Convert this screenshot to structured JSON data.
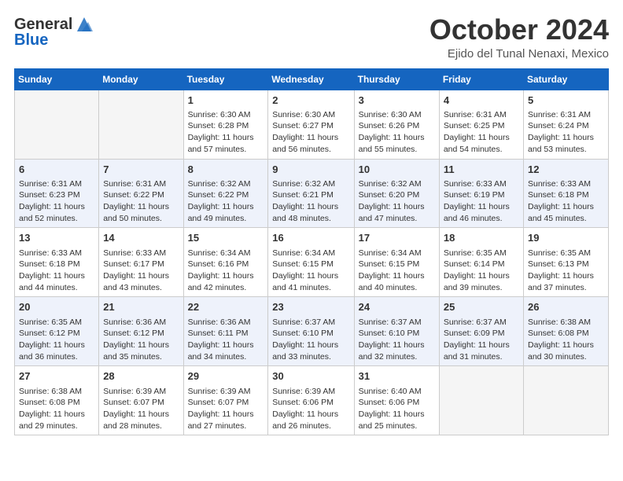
{
  "header": {
    "logo_line1": "General",
    "logo_line2": "Blue",
    "month": "October 2024",
    "location": "Ejido del Tunal Nenaxi, Mexico"
  },
  "weekdays": [
    "Sunday",
    "Monday",
    "Tuesday",
    "Wednesday",
    "Thursday",
    "Friday",
    "Saturday"
  ],
  "weeks": [
    [
      {
        "day": "",
        "sunrise": "",
        "sunset": "",
        "daylight": ""
      },
      {
        "day": "",
        "sunrise": "",
        "sunset": "",
        "daylight": ""
      },
      {
        "day": "1",
        "sunrise": "Sunrise: 6:30 AM",
        "sunset": "Sunset: 6:28 PM",
        "daylight": "Daylight: 11 hours and 57 minutes."
      },
      {
        "day": "2",
        "sunrise": "Sunrise: 6:30 AM",
        "sunset": "Sunset: 6:27 PM",
        "daylight": "Daylight: 11 hours and 56 minutes."
      },
      {
        "day": "3",
        "sunrise": "Sunrise: 6:30 AM",
        "sunset": "Sunset: 6:26 PM",
        "daylight": "Daylight: 11 hours and 55 minutes."
      },
      {
        "day": "4",
        "sunrise": "Sunrise: 6:31 AM",
        "sunset": "Sunset: 6:25 PM",
        "daylight": "Daylight: 11 hours and 54 minutes."
      },
      {
        "day": "5",
        "sunrise": "Sunrise: 6:31 AM",
        "sunset": "Sunset: 6:24 PM",
        "daylight": "Daylight: 11 hours and 53 minutes."
      }
    ],
    [
      {
        "day": "6",
        "sunrise": "Sunrise: 6:31 AM",
        "sunset": "Sunset: 6:23 PM",
        "daylight": "Daylight: 11 hours and 52 minutes."
      },
      {
        "day": "7",
        "sunrise": "Sunrise: 6:31 AM",
        "sunset": "Sunset: 6:22 PM",
        "daylight": "Daylight: 11 hours and 50 minutes."
      },
      {
        "day": "8",
        "sunrise": "Sunrise: 6:32 AM",
        "sunset": "Sunset: 6:22 PM",
        "daylight": "Daylight: 11 hours and 49 minutes."
      },
      {
        "day": "9",
        "sunrise": "Sunrise: 6:32 AM",
        "sunset": "Sunset: 6:21 PM",
        "daylight": "Daylight: 11 hours and 48 minutes."
      },
      {
        "day": "10",
        "sunrise": "Sunrise: 6:32 AM",
        "sunset": "Sunset: 6:20 PM",
        "daylight": "Daylight: 11 hours and 47 minutes."
      },
      {
        "day": "11",
        "sunrise": "Sunrise: 6:33 AM",
        "sunset": "Sunset: 6:19 PM",
        "daylight": "Daylight: 11 hours and 46 minutes."
      },
      {
        "day": "12",
        "sunrise": "Sunrise: 6:33 AM",
        "sunset": "Sunset: 6:18 PM",
        "daylight": "Daylight: 11 hours and 45 minutes."
      }
    ],
    [
      {
        "day": "13",
        "sunrise": "Sunrise: 6:33 AM",
        "sunset": "Sunset: 6:18 PM",
        "daylight": "Daylight: 11 hours and 44 minutes."
      },
      {
        "day": "14",
        "sunrise": "Sunrise: 6:33 AM",
        "sunset": "Sunset: 6:17 PM",
        "daylight": "Daylight: 11 hours and 43 minutes."
      },
      {
        "day": "15",
        "sunrise": "Sunrise: 6:34 AM",
        "sunset": "Sunset: 6:16 PM",
        "daylight": "Daylight: 11 hours and 42 minutes."
      },
      {
        "day": "16",
        "sunrise": "Sunrise: 6:34 AM",
        "sunset": "Sunset: 6:15 PM",
        "daylight": "Daylight: 11 hours and 41 minutes."
      },
      {
        "day": "17",
        "sunrise": "Sunrise: 6:34 AM",
        "sunset": "Sunset: 6:15 PM",
        "daylight": "Daylight: 11 hours and 40 minutes."
      },
      {
        "day": "18",
        "sunrise": "Sunrise: 6:35 AM",
        "sunset": "Sunset: 6:14 PM",
        "daylight": "Daylight: 11 hours and 39 minutes."
      },
      {
        "day": "19",
        "sunrise": "Sunrise: 6:35 AM",
        "sunset": "Sunset: 6:13 PM",
        "daylight": "Daylight: 11 hours and 37 minutes."
      }
    ],
    [
      {
        "day": "20",
        "sunrise": "Sunrise: 6:35 AM",
        "sunset": "Sunset: 6:12 PM",
        "daylight": "Daylight: 11 hours and 36 minutes."
      },
      {
        "day": "21",
        "sunrise": "Sunrise: 6:36 AM",
        "sunset": "Sunset: 6:12 PM",
        "daylight": "Daylight: 11 hours and 35 minutes."
      },
      {
        "day": "22",
        "sunrise": "Sunrise: 6:36 AM",
        "sunset": "Sunset: 6:11 PM",
        "daylight": "Daylight: 11 hours and 34 minutes."
      },
      {
        "day": "23",
        "sunrise": "Sunrise: 6:37 AM",
        "sunset": "Sunset: 6:10 PM",
        "daylight": "Daylight: 11 hours and 33 minutes."
      },
      {
        "day": "24",
        "sunrise": "Sunrise: 6:37 AM",
        "sunset": "Sunset: 6:10 PM",
        "daylight": "Daylight: 11 hours and 32 minutes."
      },
      {
        "day": "25",
        "sunrise": "Sunrise: 6:37 AM",
        "sunset": "Sunset: 6:09 PM",
        "daylight": "Daylight: 11 hours and 31 minutes."
      },
      {
        "day": "26",
        "sunrise": "Sunrise: 6:38 AM",
        "sunset": "Sunset: 6:08 PM",
        "daylight": "Daylight: 11 hours and 30 minutes."
      }
    ],
    [
      {
        "day": "27",
        "sunrise": "Sunrise: 6:38 AM",
        "sunset": "Sunset: 6:08 PM",
        "daylight": "Daylight: 11 hours and 29 minutes."
      },
      {
        "day": "28",
        "sunrise": "Sunrise: 6:39 AM",
        "sunset": "Sunset: 6:07 PM",
        "daylight": "Daylight: 11 hours and 28 minutes."
      },
      {
        "day": "29",
        "sunrise": "Sunrise: 6:39 AM",
        "sunset": "Sunset: 6:07 PM",
        "daylight": "Daylight: 11 hours and 27 minutes."
      },
      {
        "day": "30",
        "sunrise": "Sunrise: 6:39 AM",
        "sunset": "Sunset: 6:06 PM",
        "daylight": "Daylight: 11 hours and 26 minutes."
      },
      {
        "day": "31",
        "sunrise": "Sunrise: 6:40 AM",
        "sunset": "Sunset: 6:06 PM",
        "daylight": "Daylight: 11 hours and 25 minutes."
      },
      {
        "day": "",
        "sunrise": "",
        "sunset": "",
        "daylight": ""
      },
      {
        "day": "",
        "sunrise": "",
        "sunset": "",
        "daylight": ""
      }
    ]
  ]
}
